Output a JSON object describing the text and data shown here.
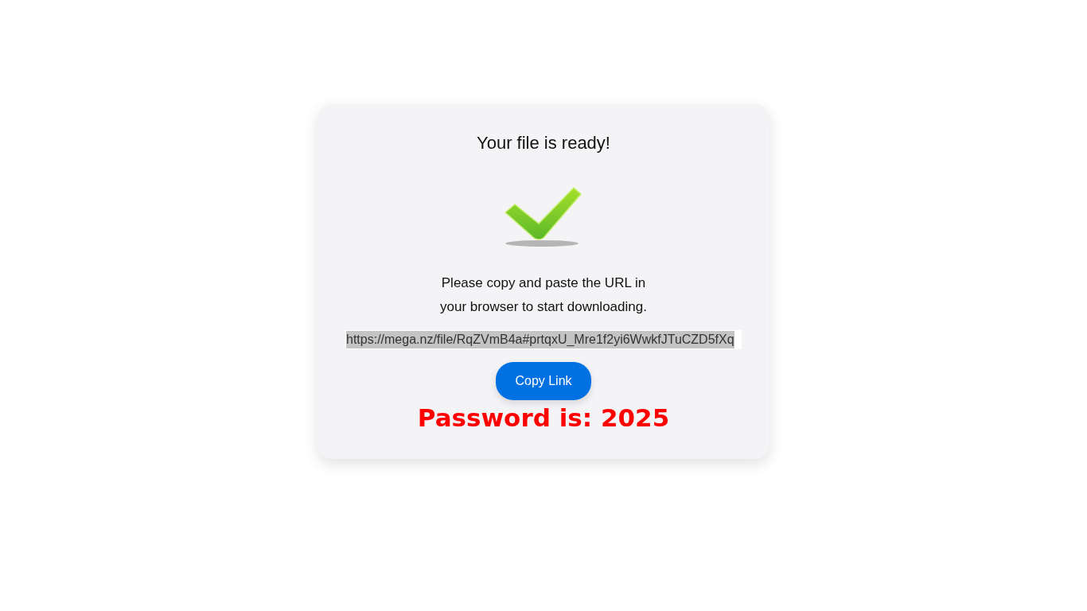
{
  "title": "Your file is ready!",
  "message_lines": [
    "Please copy and paste the URL in",
    "your browser to start downloading."
  ],
  "url_field": {
    "value": "https://mega.nz/file/RqZVmB4a#prtqxU_Mre1f2yi6WwkfJTuCZD5fXq",
    "selected": true
  },
  "copy_button": "Copy Link",
  "password_note": "Password is: 2025"
}
